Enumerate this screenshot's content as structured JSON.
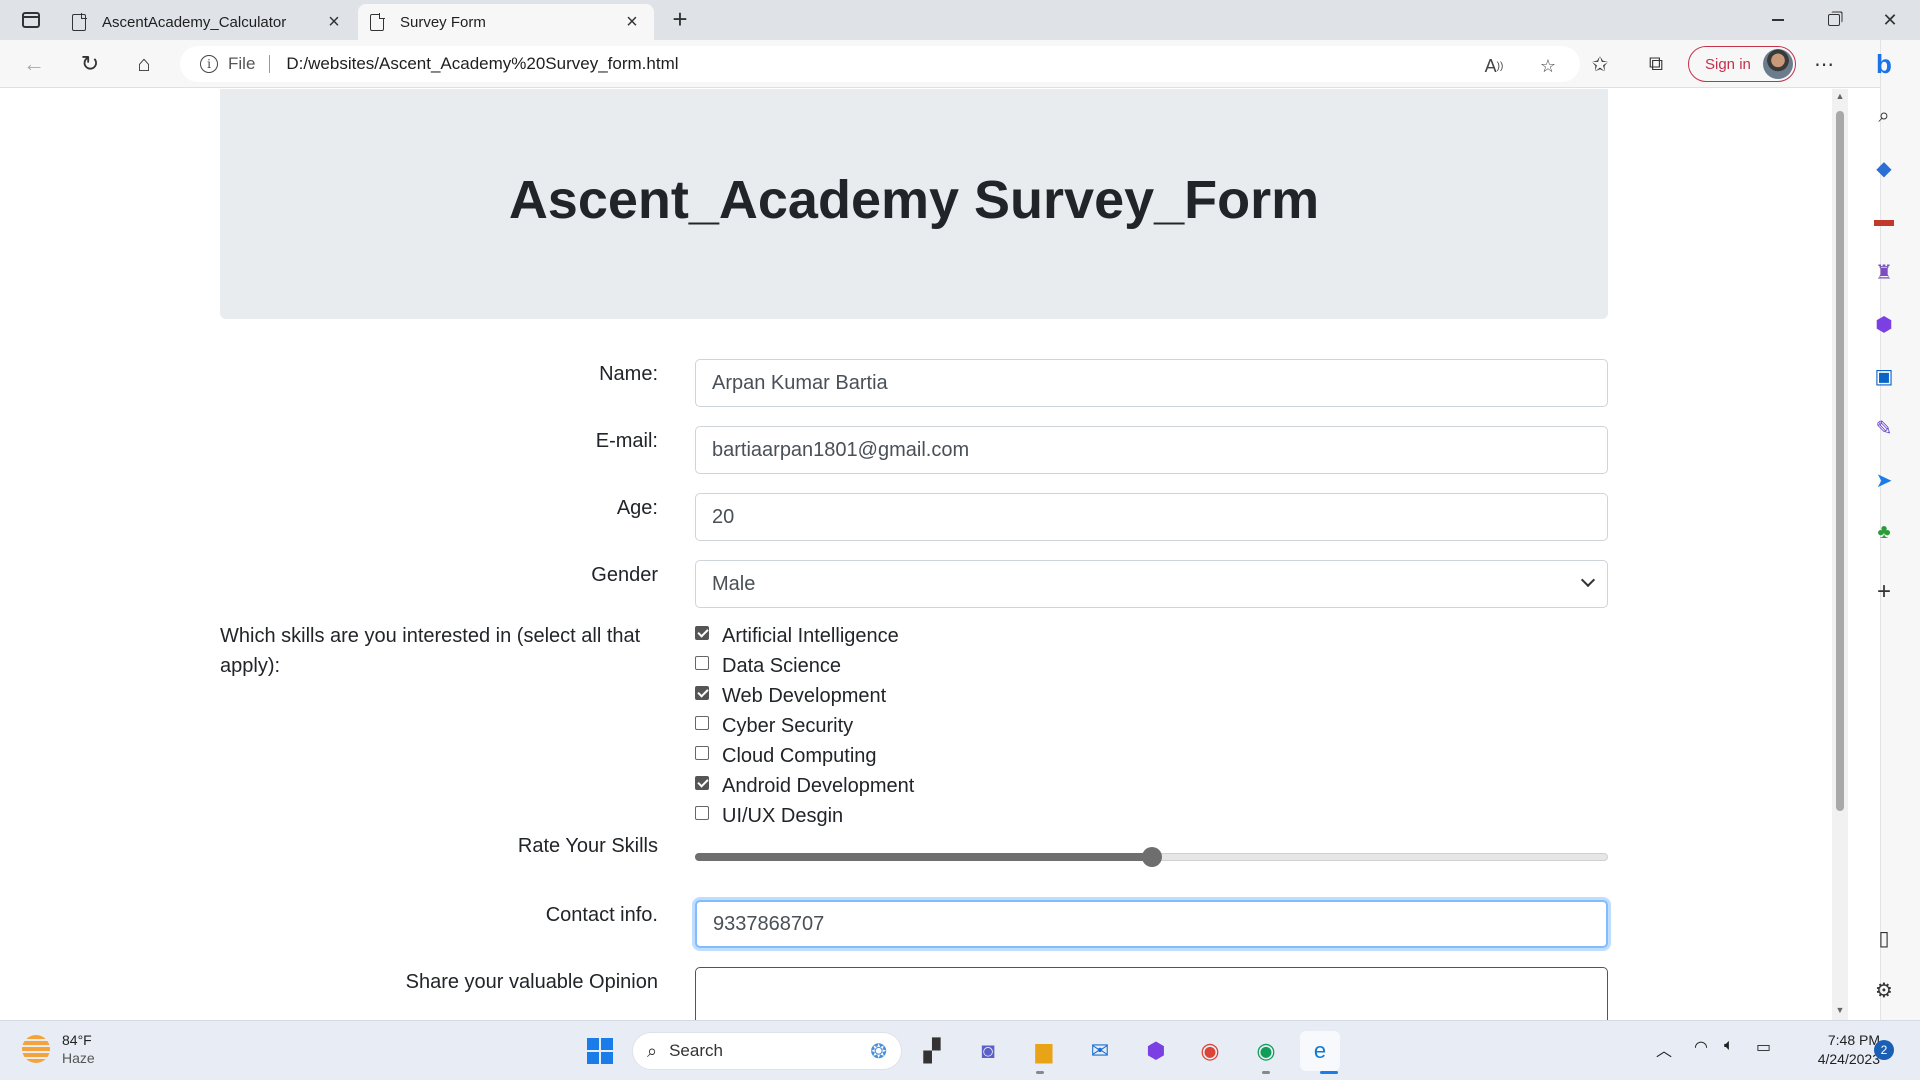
{
  "browser": {
    "tabs": [
      {
        "label": "AscentAcademy_Calculator",
        "active": false
      },
      {
        "label": "Survey Form",
        "active": true
      }
    ],
    "address": {
      "scheme": "File",
      "url": "D:/websites/Ascent_Academy%20Survey_form.html"
    },
    "signin_label": "Sign in"
  },
  "page": {
    "title": "Ascent_Academy Survey_Form",
    "form": {
      "name_label": "Name:",
      "name_value": "Arpan Kumar Bartia",
      "email_label": "E-mail:",
      "email_value": "bartiaarpan1801@gmail.com",
      "age_label": "Age:",
      "age_value": "20",
      "gender_label": "Gender",
      "gender_value": "Male",
      "skills_label": "Which skills are you interested in (select all that apply):",
      "skills": [
        {
          "label": "Artificial Intelligence",
          "checked": true
        },
        {
          "label": "Data Science",
          "checked": false
        },
        {
          "label": "Web Development",
          "checked": true
        },
        {
          "label": "Cyber Security",
          "checked": false
        },
        {
          "label": "Cloud Computing",
          "checked": false
        },
        {
          "label": "Android Development",
          "checked": true
        },
        {
          "label": "UI/UX Desgin",
          "checked": false
        }
      ],
      "rate_label": "Rate Your Skills",
      "rate_value": 0.5,
      "contact_label": "Contact info.",
      "contact_value": "9337868707",
      "opinion_label": "Share your valuable Opinion",
      "opinion_value": ""
    }
  },
  "taskbar": {
    "weather_temp": "84°F",
    "weather_desc": "Haze",
    "search_placeholder": "Search",
    "time": "7:48 PM",
    "date": "4/24/2023",
    "notifications": "2"
  }
}
